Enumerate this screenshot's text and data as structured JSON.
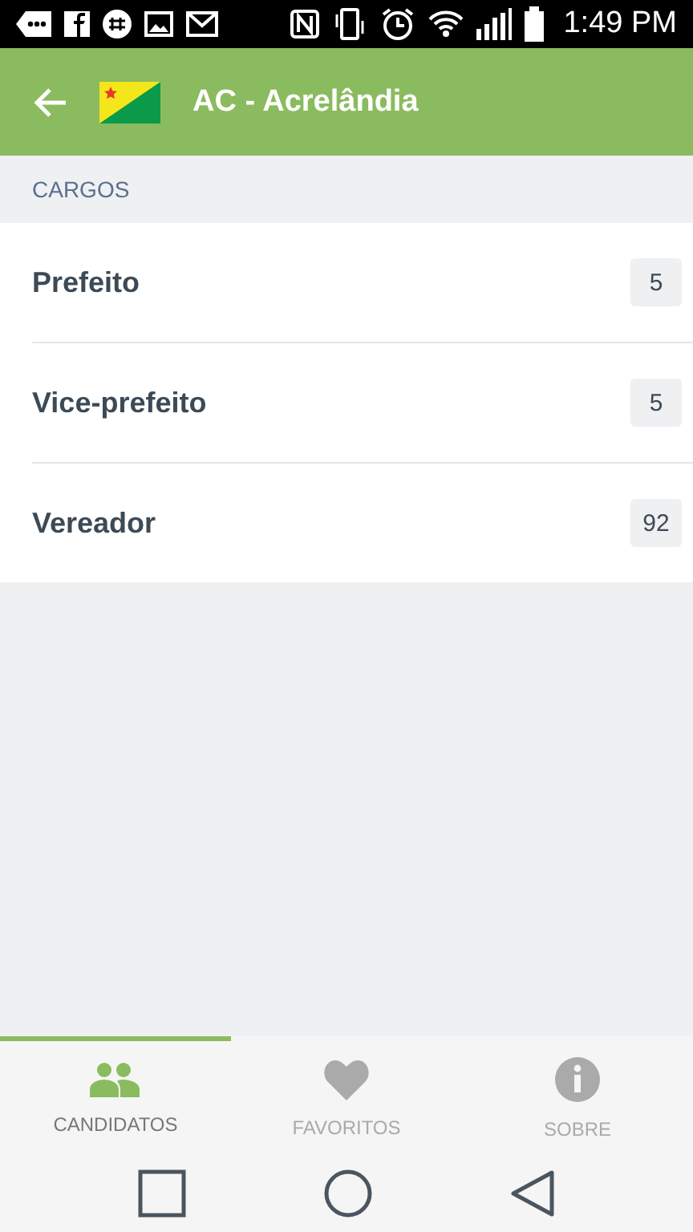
{
  "status_bar": {
    "time": "1:49 PM"
  },
  "app_bar": {
    "title": "AC - Acrelândia"
  },
  "section": {
    "title": "CARGOS"
  },
  "items": [
    {
      "label": "Prefeito",
      "count": "5"
    },
    {
      "label": "Vice-prefeito",
      "count": "5"
    },
    {
      "label": "Vereador",
      "count": "92"
    }
  ],
  "tabs": [
    {
      "label": "CANDIDATOS",
      "kind": "people",
      "selected": true
    },
    {
      "label": "FAVORITOS",
      "kind": "heart",
      "selected": false
    },
    {
      "label": "SOBRE",
      "kind": "info",
      "selected": false
    }
  ]
}
